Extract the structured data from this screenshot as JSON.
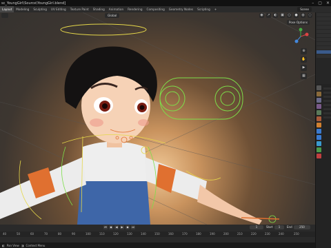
{
  "titlebar": {
    "path": "sc_YoungGirl\\Source\\YoungGirl.blend]",
    "min": "–",
    "max": "▢",
    "close": "✕"
  },
  "workspaces": [
    "Layout",
    "Modeling",
    "Sculpting",
    "UV Editing",
    "Texture Paint",
    "Shading",
    "Animation",
    "Rendering",
    "Compositing",
    "Geometry Nodes",
    "Scripting",
    "+"
  ],
  "active_workspace": "Layout",
  "scene": "Scene",
  "viewport": {
    "mode": "Global",
    "pose_options": "Pose Options"
  },
  "timeline": {
    "start_label": "Start",
    "start": "1",
    "end_label": "End",
    "end": "250",
    "current": "1",
    "ticks": [
      "40",
      "50",
      "60",
      "70",
      "80",
      "90",
      "100",
      "110",
      "120",
      "130",
      "140",
      "150",
      "160",
      "170",
      "180",
      "190",
      "200",
      "210",
      "220",
      "230",
      "240",
      "250"
    ]
  },
  "status": {
    "left": "Pan View",
    "right": "Context Menu"
  },
  "colors": {
    "accent": "#4772b3",
    "rig_green": "#7ddf4a",
    "rig_yellow": "#e6d84a"
  }
}
